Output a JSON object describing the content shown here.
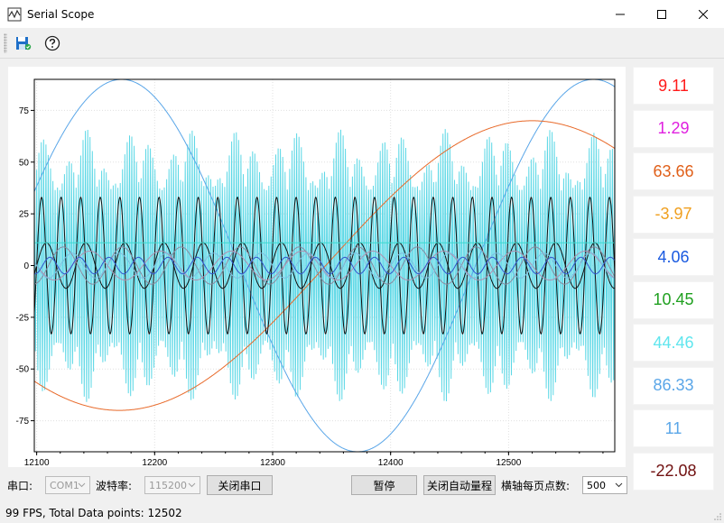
{
  "window": {
    "title": "Serial Scope"
  },
  "toolbar": {
    "save_icon": "save-icon",
    "help_icon": "help-icon"
  },
  "chart_data": {
    "type": "line",
    "xlim": [
      12098,
      12590
    ],
    "ylim": [
      -90,
      90
    ],
    "x_ticks": [
      "12100",
      "12200",
      "12300",
      "12400",
      "12500"
    ],
    "x_tick_values": [
      12100,
      12200,
      12300,
      12400,
      12500
    ],
    "y_ticks": [
      "75",
      "50",
      "25",
      "0",
      "-25",
      "-50",
      "-75"
    ],
    "y_tick_values": [
      75,
      50,
      25,
      0,
      -25,
      -50,
      -75
    ],
    "grid": true,
    "series": [
      {
        "color": "#5dd8e6",
        "shape": "noise",
        "amplitude": 66,
        "center": 0
      },
      {
        "color": "#5aa6e8",
        "shape": "sine",
        "amplitude": 90,
        "period": 400,
        "phase_x": 12072
      },
      {
        "color": "#e86a2a",
        "shape": "sine",
        "amplitude": 70,
        "period": 700,
        "phase_x": 12345
      },
      {
        "color": "#111111",
        "shape": "sine",
        "amplitude": 33,
        "period": 16.6,
        "phase_x": 12100
      },
      {
        "color": "#111111",
        "shape": "sine",
        "amplitude": 11,
        "period": 33.2,
        "phase_x": 12100
      },
      {
        "color": "#8a8aa0",
        "shape": "sine",
        "amplitude": 9,
        "period": 50,
        "phase_x": 12110
      },
      {
        "color": "#b090b0",
        "shape": "sine",
        "amplitude": 7,
        "period": 60,
        "phase_x": 12130
      },
      {
        "color": "#7fbde0",
        "shape": "sine",
        "amplitude": 6,
        "period": 40,
        "phase_x": 12120
      },
      {
        "color": "#3355cc",
        "shape": "sine",
        "amplitude": 4,
        "period": 25,
        "phase_x": 12105
      },
      {
        "color": "#3ddbd0",
        "shape": "flat",
        "value": 11
      }
    ]
  },
  "values": [
    {
      "text": "9.11",
      "color": "#ff1a1a"
    },
    {
      "text": "1.29",
      "color": "#e020e0"
    },
    {
      "text": "63.66",
      "color": "#e0601a"
    },
    {
      "text": "-3.97",
      "color": "#f0a020"
    },
    {
      "text": "4.06",
      "color": "#1a5ae0"
    },
    {
      "text": "10.45",
      "color": "#20a020"
    },
    {
      "text": "44.46",
      "color": "#60e6ee"
    },
    {
      "text": "86.33",
      "color": "#5aa6e8"
    },
    {
      "text": "11",
      "color": "#5aa6e8"
    },
    {
      "text": "-22.08",
      "color": "#701010"
    }
  ],
  "controls": {
    "port_label": "串口:",
    "port_value": "COM1",
    "baud_label": "波特率:",
    "baud_value": "115200",
    "close_port_label": "关闭串口",
    "pause_label": "暂停",
    "auto_range_label": "关闭自动量程",
    "points_label": "横轴每页点数:",
    "points_value": "500"
  },
  "status": {
    "text": "99 FPS, Total Data points: 12502"
  }
}
